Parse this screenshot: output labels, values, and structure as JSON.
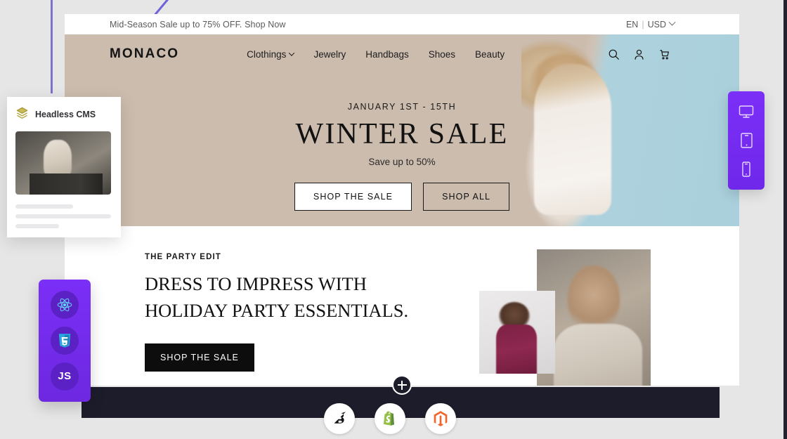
{
  "colors": {
    "page_bg": "#e6e6e6",
    "accent_purple": "#7b2ff7",
    "guide_purple": "#7b74c9",
    "hero_bg": "#cbbcae",
    "dark_bar": "#1c1c2b",
    "cms_icon_gold": "#b5a642"
  },
  "guides": {
    "vertical_line": "vertical-guide-line",
    "diagonal_line": "diagonal-guide-line"
  },
  "cms_card": {
    "icon": "layers-icon",
    "title": "Headless CMS",
    "image_alt": "fashion-model-seated-editorial",
    "skeleton_lines": 3
  },
  "tech_rail": {
    "items": [
      {
        "icon": "react-icon",
        "label": ""
      },
      {
        "icon": "css3-icon",
        "label": "3"
      },
      {
        "icon": "javascript-icon",
        "label": "JS"
      }
    ]
  },
  "device_rail": {
    "items": [
      {
        "icon": "desktop-icon",
        "label": "Desktop"
      },
      {
        "icon": "tablet-icon",
        "label": "Tablet"
      },
      {
        "icon": "mobile-icon",
        "label": "Mobile"
      }
    ]
  },
  "storefront": {
    "announcement": {
      "text": "Mid-Season Sale up to 75% OFF. Shop Now",
      "language": "EN",
      "divider": "|",
      "currency": "USD",
      "chevron": "chevron-down-icon"
    },
    "header": {
      "logo": "MONACO",
      "nav": [
        {
          "label": "Clothings",
          "has_dropdown": true
        },
        {
          "label": "Jewelry",
          "has_dropdown": false
        },
        {
          "label": "Handbags",
          "has_dropdown": false
        },
        {
          "label": "Shoes",
          "has_dropdown": false
        },
        {
          "label": "Beauty",
          "has_dropdown": false
        }
      ],
      "icons": [
        "search-icon",
        "account-icon",
        "cart-icon"
      ]
    },
    "hero": {
      "kicker": "JANUARY 1ST - 15TH",
      "title": "WINTER SALE",
      "subtitle": "Save up to 50%",
      "primary_button": "SHOP THE SALE",
      "secondary_button": "SHOP ALL",
      "image_alt": "curly-hair-model-white-dress"
    },
    "editorial": {
      "kicker": "THE PARTY EDIT",
      "headline": "DRESS TO IMPRESS WITH HOLIDAY PARTY ESSENTIALS.",
      "button": "SHOP THE SALE",
      "image_large_alt": "model-beige-shirt-portrait",
      "image_small_alt": "model-burgundy-dress"
    }
  },
  "bottom_bar": {
    "add_button": "plus-icon",
    "platforms": [
      {
        "icon": "bigcommerce-icon",
        "name": "BigCommerce"
      },
      {
        "icon": "shopify-icon",
        "name": "Shopify"
      },
      {
        "icon": "magento-icon",
        "name": "Magento"
      }
    ]
  }
}
